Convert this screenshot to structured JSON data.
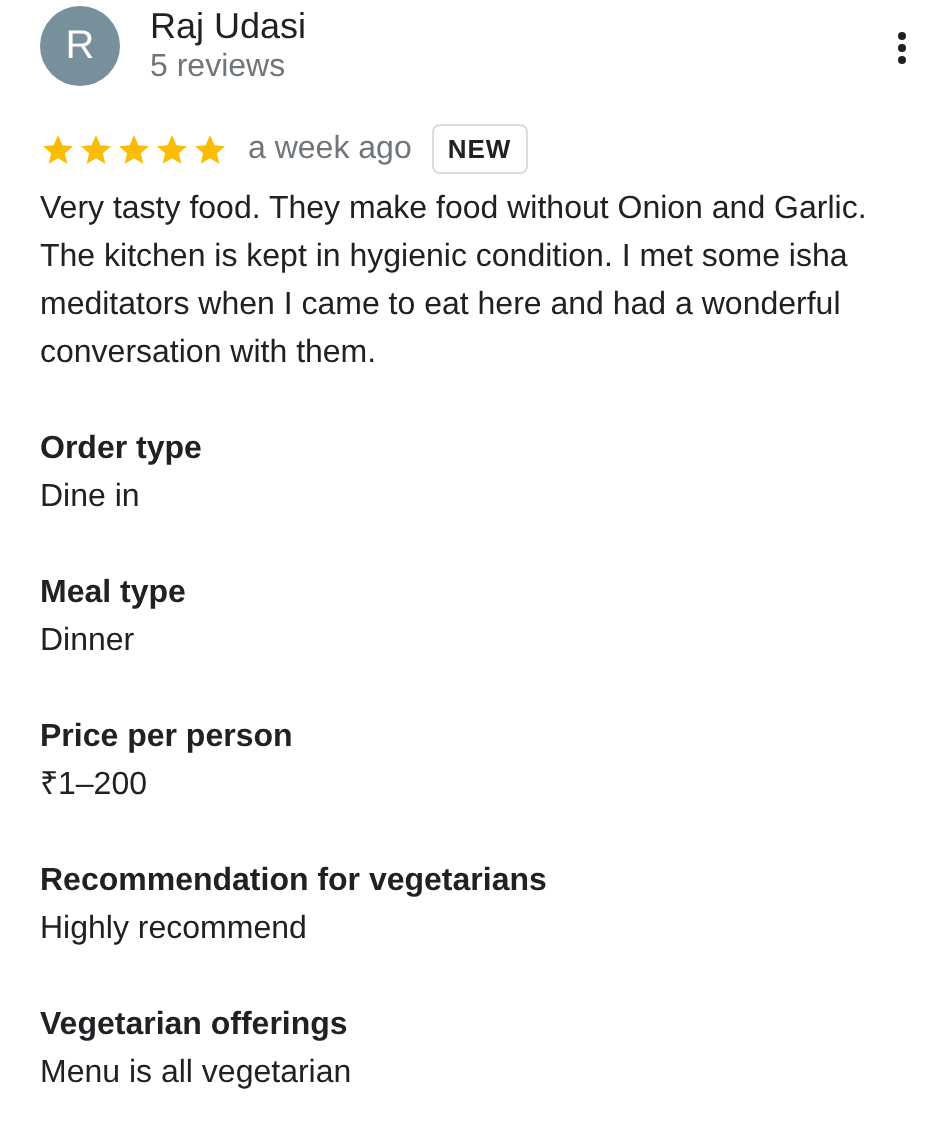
{
  "reviewer": {
    "initial": "R",
    "name": "Raj Udasi",
    "meta": "5 reviews"
  },
  "rating": {
    "stars": 5,
    "time": "a week ago",
    "badge": "NEW"
  },
  "review_text": "Very tasty food. They make food without Onion and Garlic. The kitchen is kept in hygienic condition. I met some isha meditators when I came to eat here and had a wonderful conversation with them.",
  "details": [
    {
      "label": "Order type",
      "value": "Dine in"
    },
    {
      "label": "Meal type",
      "value": "Dinner"
    },
    {
      "label": "Price per person",
      "value": "₹1–200"
    },
    {
      "label": "Recommendation for vegetarians",
      "value": "Highly recommend"
    },
    {
      "label": "Vegetarian offerings",
      "value": "Menu is all vegetarian"
    }
  ]
}
